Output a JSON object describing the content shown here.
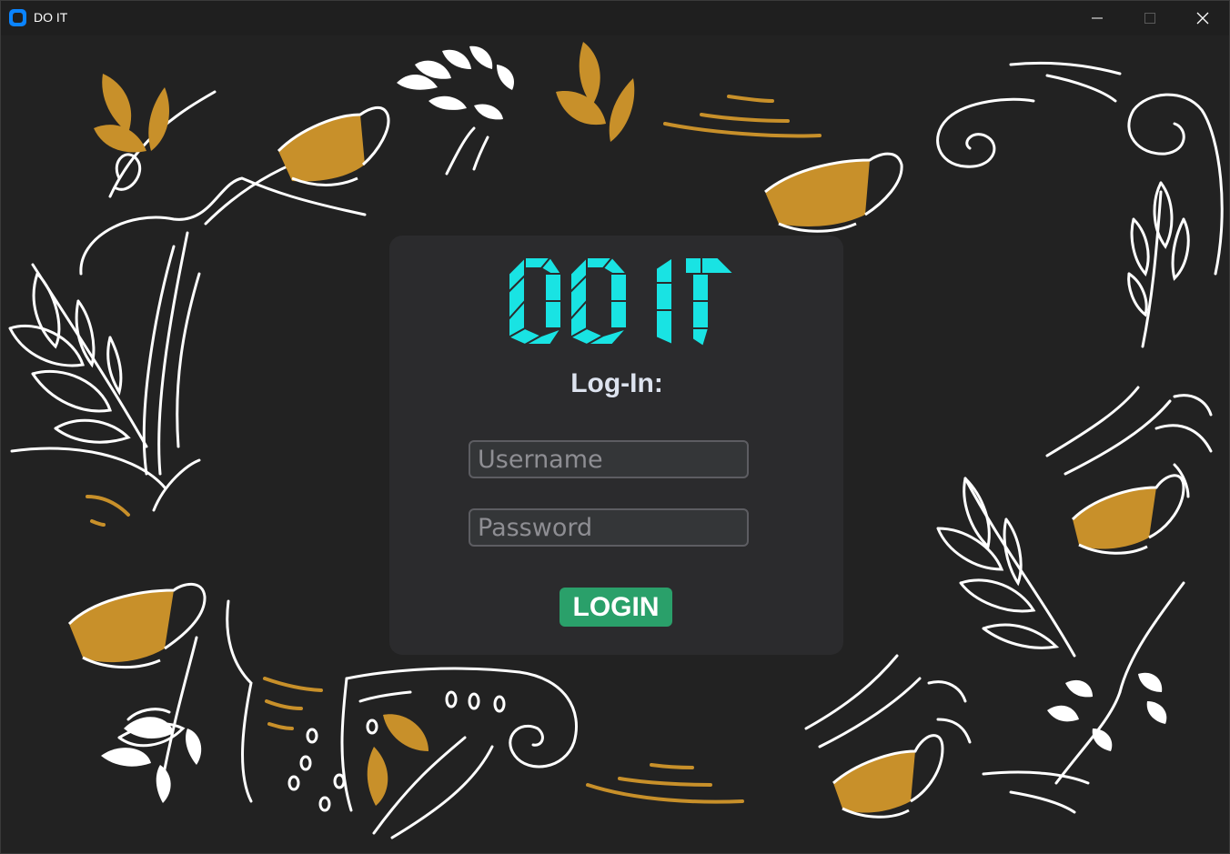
{
  "window": {
    "title": "DO IT",
    "controls": {
      "minimize_icon": "minimize-icon",
      "maximize_icon": "maximize-icon",
      "close_icon": "close-icon"
    }
  },
  "login": {
    "logo_text": "DO IT",
    "heading": "Log-In:",
    "username_placeholder": "Username",
    "password_placeholder": "Password",
    "button_label": "LOGIN"
  },
  "colors": {
    "background": "#222222",
    "card": "#2b2b2d",
    "logo": "#19e3e3",
    "accent_gold": "#c8902a",
    "button": "#2aa06a",
    "heading": "#dde3ef"
  }
}
